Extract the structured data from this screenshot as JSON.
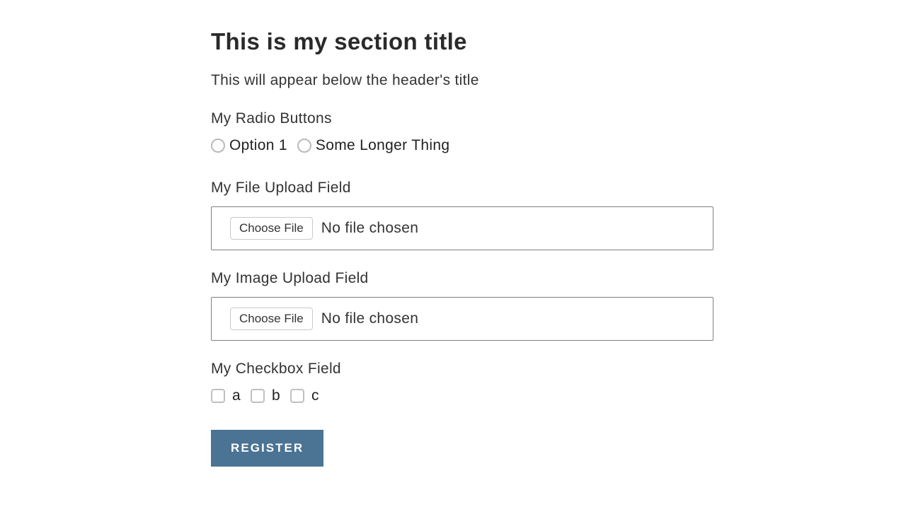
{
  "section": {
    "title": "This is my section title",
    "subtitle": "This will appear below the header's title"
  },
  "radio": {
    "label": "My Radio Buttons",
    "options": [
      {
        "label": "Option 1"
      },
      {
        "label": "Some Longer Thing"
      }
    ]
  },
  "file_upload": {
    "label": "My File Upload Field",
    "button": "Choose File",
    "status": "No file chosen"
  },
  "image_upload": {
    "label": "My Image Upload Field",
    "button": "Choose File",
    "status": "No file chosen"
  },
  "checkbox": {
    "label": "My Checkbox Field",
    "options": [
      {
        "label": "a"
      },
      {
        "label": "b"
      },
      {
        "label": "c"
      }
    ]
  },
  "submit": {
    "label": "REGISTER"
  }
}
